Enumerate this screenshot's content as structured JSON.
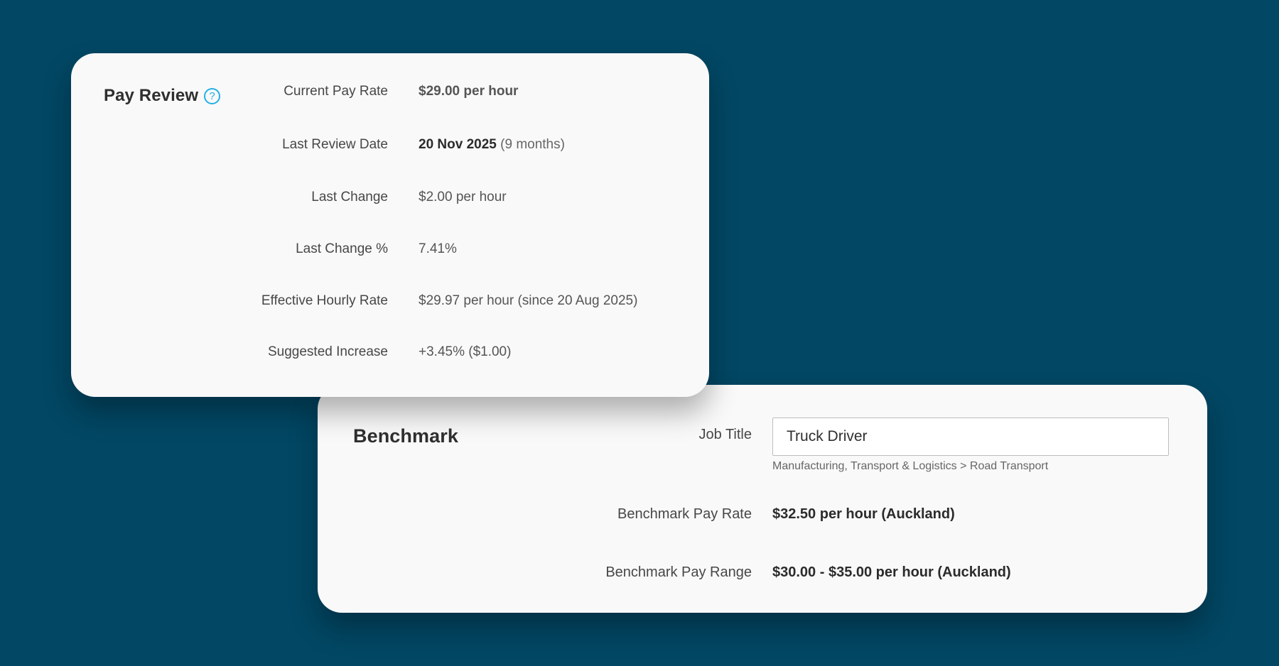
{
  "pay_review": {
    "title": "Pay Review",
    "help_icon": "?",
    "current_pay_rate": {
      "label": "Current Pay Rate",
      "value": "$29.00 per hour"
    },
    "last_review_date": {
      "label": "Last Review Date",
      "date": "20 Nov 2025",
      "relative": "(9 months)"
    },
    "last_change": {
      "label": "Last Change",
      "value": "$2.00 per hour"
    },
    "last_change_percent": {
      "label": "Last Change %",
      "value": "7.41%"
    },
    "effective_hourly_rate": {
      "label": "Effective Hourly Rate",
      "value": "$29.97 per hour (since 20 Aug 2025)"
    },
    "suggested_increase": {
      "label": "Suggested Increase",
      "value": "+3.45% ($1.00)"
    }
  },
  "benchmark": {
    "title": "Benchmark",
    "job_title": {
      "label": "Job Title",
      "value": "Truck Driver",
      "category": "Manufacturing, Transport & Logistics > Road Transport"
    },
    "pay_rate": {
      "label": "Benchmark Pay Rate",
      "value": "$32.50 per hour (Auckland)"
    },
    "pay_range": {
      "label": "Benchmark Pay Range",
      "value": "$30.00 - $35.00 per hour (Auckland)"
    }
  },
  "colors": {
    "background": "#024764",
    "card": "#f9f9f9",
    "help_icon": "#21b2e5"
  }
}
